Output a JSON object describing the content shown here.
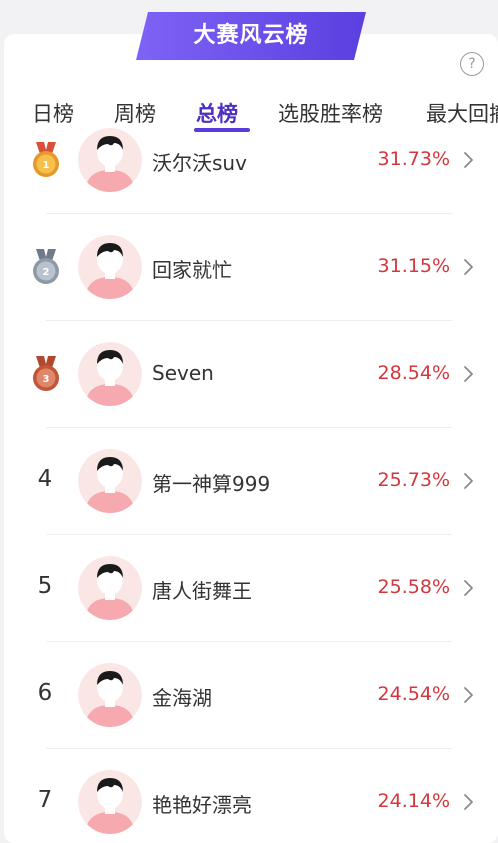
{
  "header": {
    "banner_title": "大赛风云榜",
    "help_icon": "?"
  },
  "colors": {
    "accent": "#4e2fbe",
    "banner": "#6a4df0",
    "rate": "#d2373e",
    "gold": "#e49a2a",
    "silver": "#9ba6b3",
    "bronze": "#c8643e"
  },
  "tabs": [
    {
      "label": "日榜",
      "active": false
    },
    {
      "label": "周榜",
      "active": false
    },
    {
      "label": "总榜",
      "active": true
    },
    {
      "label": "选股胜率榜",
      "active": false
    },
    {
      "label": "最大回撤",
      "active": false
    }
  ],
  "rows": [
    {
      "rank": "1",
      "medal": "gold",
      "name": "沃尔沃suv",
      "rate": "31.73%"
    },
    {
      "rank": "2",
      "medal": "silver",
      "name": "回家就忙",
      "rate": "31.15%"
    },
    {
      "rank": "3",
      "medal": "bronze",
      "name": "Seven",
      "rate": "28.54%"
    },
    {
      "rank": "4",
      "medal": null,
      "name": "第一神算999",
      "rate": "25.73%"
    },
    {
      "rank": "5",
      "medal": null,
      "name": "唐人街舞王",
      "rate": "25.58%"
    },
    {
      "rank": "6",
      "medal": null,
      "name": "金海湖",
      "rate": "24.54%"
    },
    {
      "rank": "7",
      "medal": null,
      "name": "艳艳好漂亮",
      "rate": "24.14%"
    }
  ],
  "icons": {
    "row_arrow": "chevron-right-icon",
    "avatar": "default-avatar-icon",
    "help": "question-circle-icon"
  }
}
